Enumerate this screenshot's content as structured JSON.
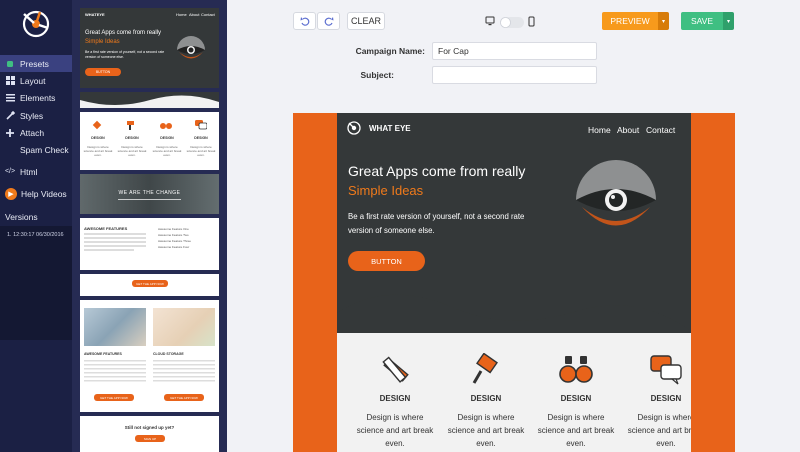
{
  "sidebar": {
    "items": [
      {
        "label": "Presets",
        "icon": "presets-icon"
      },
      {
        "label": "Layout",
        "icon": "layout-icon"
      },
      {
        "label": "Elements",
        "icon": "elements-icon"
      },
      {
        "label": "Styles",
        "icon": "styles-icon"
      },
      {
        "label": "Attach",
        "icon": "attach-icon"
      },
      {
        "label": "Spam Check",
        "icon": "spam-check-icon"
      },
      {
        "label": "Html",
        "icon": "html-icon"
      },
      {
        "label": "Help Videos",
        "icon": "help-videos-icon"
      }
    ],
    "versions_title": "Versions",
    "versions": [
      "1. 12:30:17 06/30/2016"
    ]
  },
  "templates": {
    "t1": {
      "brand": "WHATEYE",
      "nav": [
        "Home",
        "About",
        "Contact"
      ],
      "title": "Great Apps come from really",
      "subtitle": "Simple Ideas",
      "desc": "Be a first rate version of yourself, not a second rate version of someone else.",
      "button": "BUTTON"
    },
    "t3": {
      "labels": [
        "DESIGN",
        "DESIGN",
        "DESIGN",
        "DESIGN"
      ],
      "desc": "Design is where science and art break even."
    },
    "t4": {
      "title": "WE ARE THE CHANGE"
    },
    "t5": {
      "heading": "AWESOME FEATURES",
      "features": [
        "Awesome Feature One",
        "Awesome Feature Two",
        "Awesome Feature Three",
        "Awesome Feature Four"
      ],
      "button": "GET THE APP NOW"
    },
    "t7": {
      "left_title": "AWESOME FEATURES",
      "right_title": "CLOUD STORAGE",
      "button": "GET THE APP NOW"
    },
    "t8": {
      "title": "Still not signed up yet?",
      "button": "SIGN UP"
    }
  },
  "toolbar": {
    "undo_icon": "undo-icon",
    "redo_icon": "redo-icon",
    "clear_label": "CLEAR",
    "preview_label": "PREVIEW",
    "save_label": "SAVE"
  },
  "form": {
    "campaign_label": "Campaign Name:",
    "campaign_value": "For Cap",
    "subject_label": "Subject:",
    "subject_value": ""
  },
  "email": {
    "brand": "WHAT EYE",
    "nav": [
      "Home",
      "About",
      "Contact"
    ],
    "hero_title": "Great Apps come from really",
    "hero_subtitle": "Simple Ideas",
    "hero_desc": "Be a first rate version of yourself, not a second rate version of someone else.",
    "hero_button": "BUTTON",
    "features": [
      {
        "icon": "pencil-ruler-icon",
        "title": "DESIGN",
        "desc": "Design is where science and art break even."
      },
      {
        "icon": "paint-roller-icon",
        "title": "DESIGN",
        "desc": "Design is where science and art break even."
      },
      {
        "icon": "binoculars-icon",
        "title": "DESIGN",
        "desc": "Design is where science and art break even."
      },
      {
        "icon": "chat-bubbles-icon",
        "title": "DESIGN",
        "desc": "Design is where science and art break even."
      }
    ]
  },
  "colors": {
    "sidebar_bg": "#1b2044",
    "panel_bg": "#262b53",
    "accent_orange": "#e8631a",
    "preview_orange": "#f79a1c",
    "save_green": "#3fbf82",
    "hero_dark": "#343839"
  }
}
